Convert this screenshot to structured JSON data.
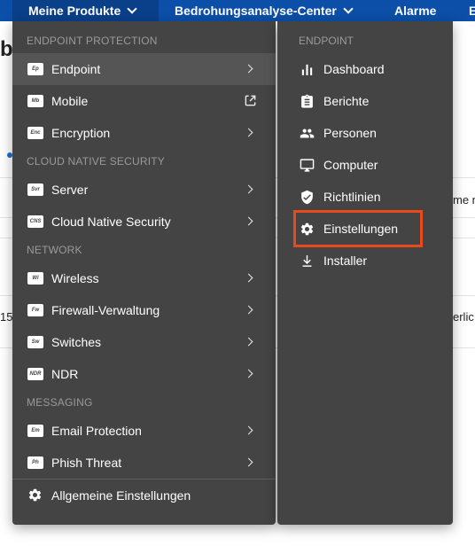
{
  "top_nav": {
    "items": [
      {
        "label": "Meine Produkte"
      },
      {
        "label": "Bedrohungsanalyse-Center"
      },
      {
        "label": "Alarme"
      },
      {
        "label": "E"
      }
    ]
  },
  "background": {
    "fragments": [
      "b",
      "me n",
      "15:",
      "erlic"
    ]
  },
  "menu": {
    "sections": [
      {
        "title": "ENDPOINT PROTECTION",
        "items": [
          {
            "badge": "Ep",
            "label": "Endpoint"
          },
          {
            "badge": "Mb",
            "label": "Mobile"
          },
          {
            "badge": "Enc",
            "label": "Encryption"
          }
        ]
      },
      {
        "title": "CLOUD NATIVE SECURITY",
        "items": [
          {
            "badge": "Svr",
            "label": "Server"
          },
          {
            "badge": "CNS",
            "label": "Cloud Native Security"
          }
        ]
      },
      {
        "title": "NETWORK",
        "items": [
          {
            "badge": "Wi",
            "label": "Wireless"
          },
          {
            "badge": "Fw",
            "label": "Firewall-Verwaltung"
          },
          {
            "badge": "Sw",
            "label": "Switches"
          },
          {
            "badge": "NDR",
            "label": "NDR"
          }
        ]
      },
      {
        "title": "MESSAGING",
        "items": [
          {
            "badge": "Em",
            "label": "Email Protection"
          },
          {
            "badge": "Ph",
            "label": "Phish Threat"
          }
        ]
      }
    ],
    "footer_label": "Allgemeine Einstellungen"
  },
  "submenu": {
    "title": "ENDPOINT",
    "items": [
      {
        "icon": "bar-chart-icon",
        "label": "Dashboard"
      },
      {
        "icon": "clipboard-icon",
        "label": "Berichte"
      },
      {
        "icon": "people-icon",
        "label": "Personen"
      },
      {
        "icon": "monitor-icon",
        "label": "Computer"
      },
      {
        "icon": "shield-check-icon",
        "label": "Richtlinien"
      },
      {
        "icon": "gear-icon",
        "label": "Einstellungen"
      },
      {
        "icon": "download-icon",
        "label": "Installer"
      }
    ],
    "selected_index": 5
  },
  "colors": {
    "nav_bg": "#0b4fa8",
    "menu_bg": "#444444",
    "highlight_bg": "#555555",
    "selection_outline": "#e9491b"
  }
}
